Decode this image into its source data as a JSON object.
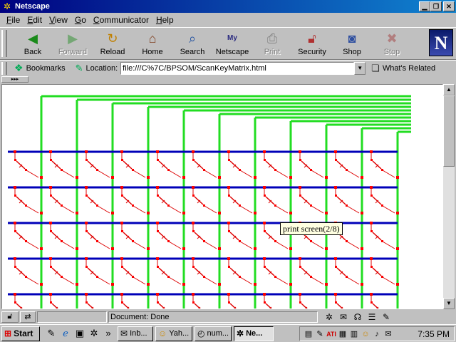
{
  "window": {
    "title": "Netscape"
  },
  "menu": [
    {
      "label": "File",
      "accel": "F"
    },
    {
      "label": "Edit",
      "accel": "E"
    },
    {
      "label": "View",
      "accel": "V"
    },
    {
      "label": "Go",
      "accel": "G"
    },
    {
      "label": "Communicator",
      "accel": "C"
    },
    {
      "label": "Help",
      "accel": "H"
    }
  ],
  "toolbar": {
    "back": "Back",
    "forward": "Forward",
    "reload": "Reload",
    "home": "Home",
    "search": "Search",
    "netscape": "Netscape",
    "print": "Print",
    "security": "Security",
    "shop": "Shop",
    "stop": "Stop",
    "disabled": [
      "Forward",
      "Print",
      "Stop"
    ]
  },
  "locationbar": {
    "bookmarks": "Bookmarks",
    "location_label": "Location:",
    "url": "file:///C%7C/BPSOM/ScanKeyMatrix.html",
    "whats_related": "What's Related"
  },
  "diagram": {
    "description_colors": {
      "row_line": "#0000b8",
      "column_line": "#22dd22",
      "node": "#ff0000",
      "switch": "#dd0000"
    },
    "rows": 5,
    "columns": 10,
    "bus_lines": 11
  },
  "tooltip": {
    "text": "print screen(2/8)"
  },
  "status": {
    "text": "Document: Done"
  },
  "taskbar": {
    "start": "Start",
    "tasks": [
      "Inb...",
      "Yah...",
      "num...",
      "Ne..."
    ],
    "clock": "7:35 PM"
  }
}
